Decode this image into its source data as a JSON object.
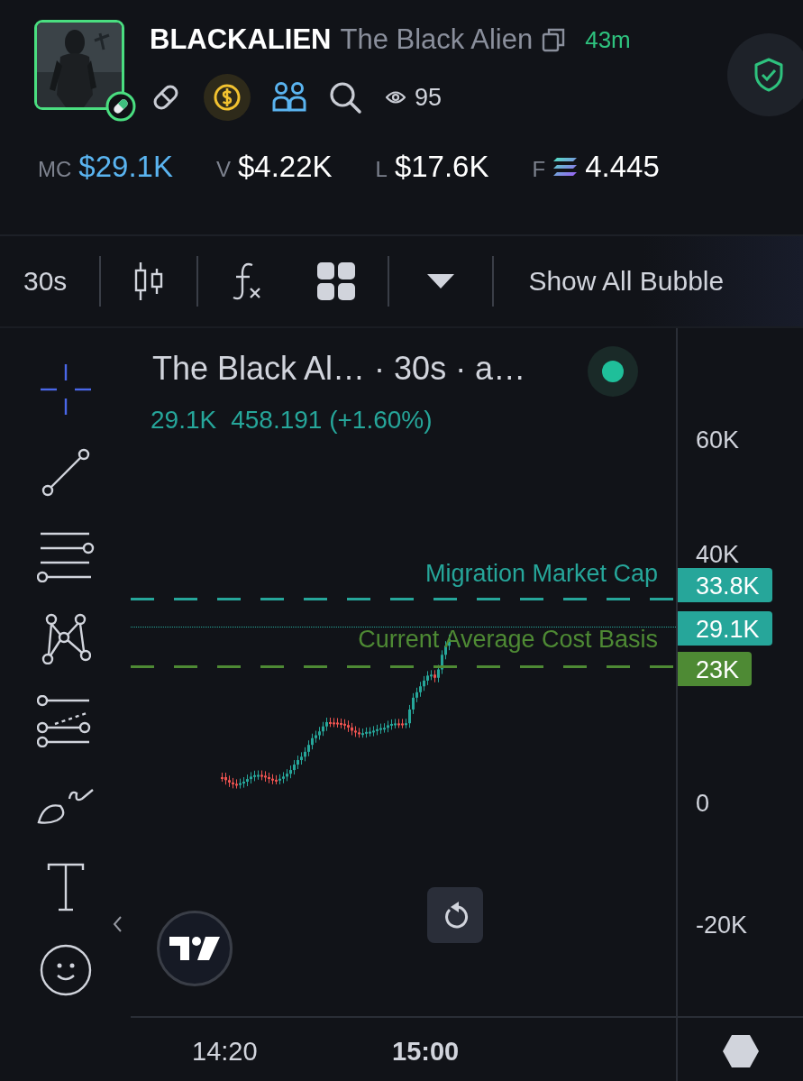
{
  "token": {
    "symbol": "BLACKALIEN",
    "name": "The Black Alien",
    "age": "43m",
    "views": "95"
  },
  "stats": [
    {
      "label": "MC",
      "value": "$29.1K",
      "color": "#5ab4f0",
      "kind": "usd"
    },
    {
      "label": "V",
      "value": "$4.22K",
      "color": "#ffffff",
      "kind": "usd"
    },
    {
      "label": "L",
      "value": "$17.6K",
      "color": "#ffffff",
      "kind": "usd"
    },
    {
      "label": "F",
      "value": "4.445",
      "color": "#ffffff",
      "kind": "sol"
    }
  ],
  "toolbar": {
    "interval": "30s",
    "bubbles": "Show All Bubble"
  },
  "drawing_tools": [
    {
      "kind": "crosshair",
      "selected": true
    },
    {
      "kind": "trendline",
      "selected": false
    },
    {
      "kind": "hlines",
      "selected": false
    },
    {
      "kind": "pattern",
      "selected": false
    },
    {
      "kind": "fib",
      "selected": false
    },
    {
      "kind": "brush",
      "selected": false
    },
    {
      "kind": "text",
      "selected": false
    },
    {
      "kind": "emoji",
      "selected": false
    }
  ],
  "chart": {
    "legend_title": "The Black Al… · 30s · a…",
    "legend_price": "29.1K",
    "legend_change": "458.191 (+1.60%)",
    "y_ticks": [
      "60K",
      "40K",
      "0",
      "-20K"
    ],
    "levels": [
      {
        "kind": "dashed",
        "label": "Migration Market Cap",
        "tag": "33.8K",
        "color": "#26a69a"
      },
      {
        "kind": "dotted",
        "tag": "29.1K",
        "color": "#26a69a"
      },
      {
        "kind": "dashed",
        "label": "Current Average Cost Basis",
        "tag": "23K",
        "color": "#4e8a34"
      }
    ],
    "x_ticks": [
      {
        "label": "14:20",
        "kind": "minor"
      },
      {
        "label": "15:00",
        "kind": "major"
      }
    ]
  }
}
